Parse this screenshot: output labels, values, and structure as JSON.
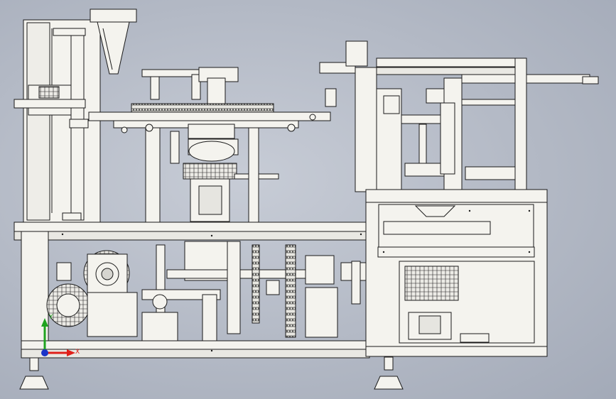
{
  "triad": {
    "x_label": "X",
    "y_label": "Y",
    "x_color": "#e0201a",
    "y_color": "#1fa31f",
    "z_color": "#1b34c8"
  },
  "model": {
    "line_color": "#1a1a1a",
    "body_fill": "#f4f3ee",
    "shade_fill": "#d9d9d4"
  }
}
